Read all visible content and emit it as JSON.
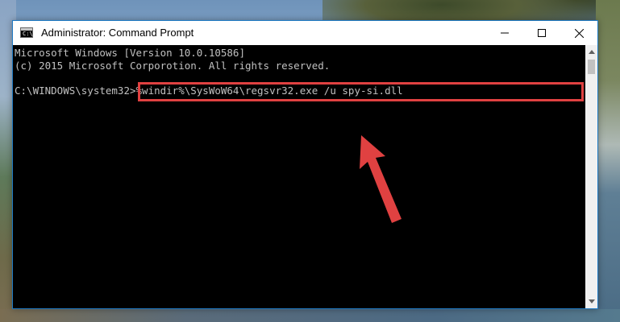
{
  "window": {
    "title": "Administrator: Command Prompt",
    "icon": "cmd-icon",
    "controls": {
      "minimize": "minimize-icon",
      "maximize": "maximize-icon",
      "close": "close-icon"
    }
  },
  "app_icon_glyph": "C:\\",
  "console": {
    "line1": "Microsoft Windows [Version 10.0.10586]",
    "line2": "(c) 2015 Microsoft Corporotion. All rights reserved.",
    "prompt": "C:\\WINDOWS\\system32>",
    "command": "%windir%\\SysWoW64\\regsvr32.exe /u spy-si.dll"
  },
  "colors": {
    "highlight_border": "#e04141",
    "arrow": "#e04141",
    "console_background": "#000000",
    "console_text": "#c0c0c0"
  }
}
